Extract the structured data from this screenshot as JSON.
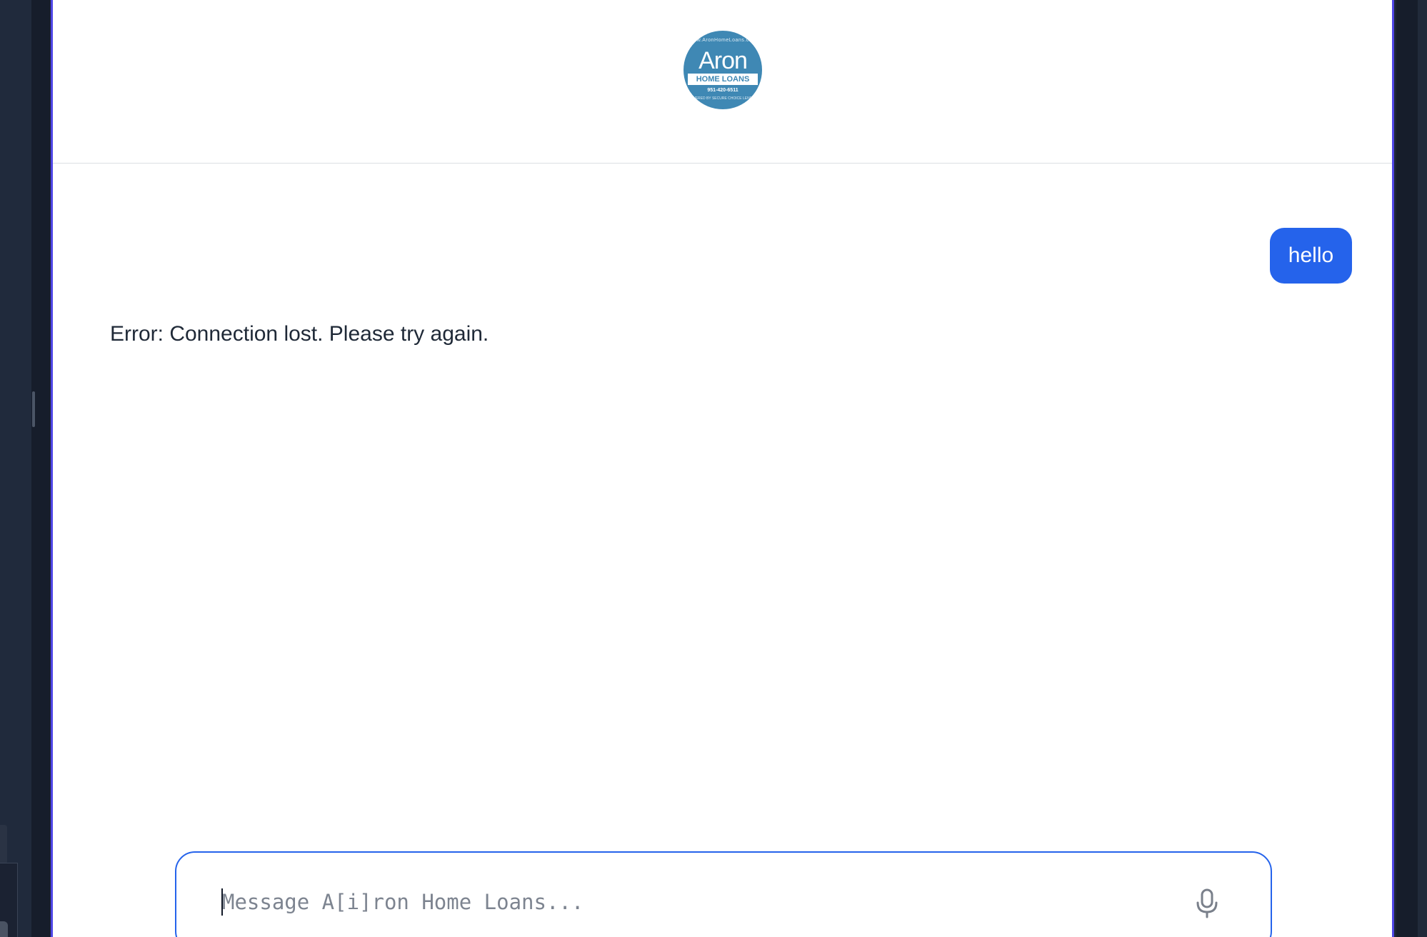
{
  "header": {
    "logo": {
      "ring_text": "www.AronHomeLoans.com",
      "name": "Aron",
      "band": "HOME LOANS",
      "phone": "951-420-6511",
      "bottom_text": "POWERED BY SECURE CHOICE LENDING"
    }
  },
  "messages": [
    {
      "role": "user",
      "text": "hello"
    },
    {
      "role": "assistant",
      "text": "Error: Connection lost. Please try again."
    }
  ],
  "composer": {
    "value": "",
    "placeholder": "Message A[i]ron Home Loans...",
    "mic_icon": "microphone-icon"
  },
  "colors": {
    "accent": "#2563eb",
    "window_border": "#4f46e5",
    "logo": "#3f88b4"
  }
}
